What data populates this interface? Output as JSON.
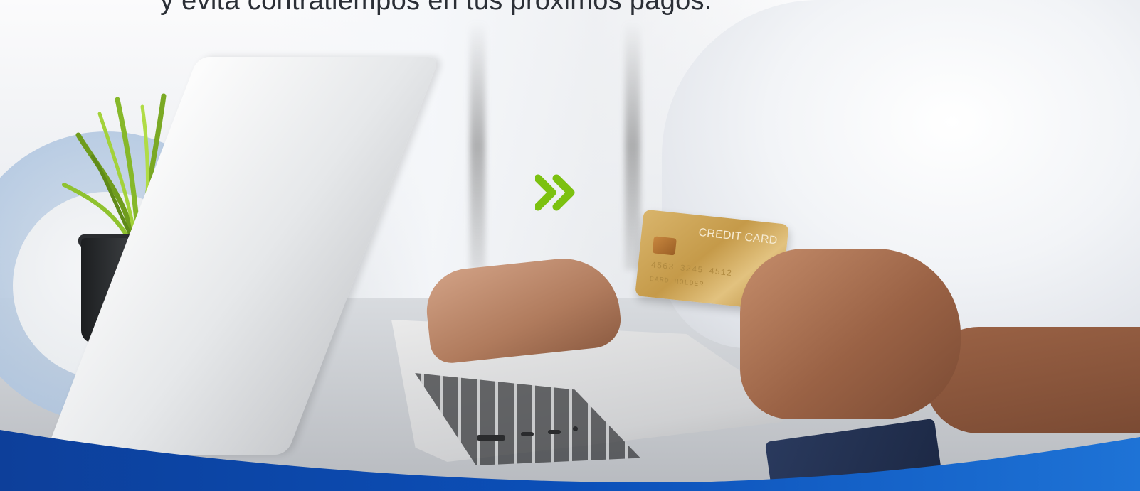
{
  "banner": {
    "headline": "y evita contratiempos en tus próximos pagos.",
    "credit_card_label": "CREDIT CARD",
    "credit_card_number": "4563 3245 4512",
    "credit_card_holder": "CARD HOLDER"
  },
  "colors": {
    "accent_green": "#7cc110",
    "brand_blue": "#0d3f9a",
    "brand_blue_light": "#1e73d6",
    "headline_text": "#2b2f36"
  },
  "icons": {
    "chevrons": "double-chevron-right-icon"
  }
}
